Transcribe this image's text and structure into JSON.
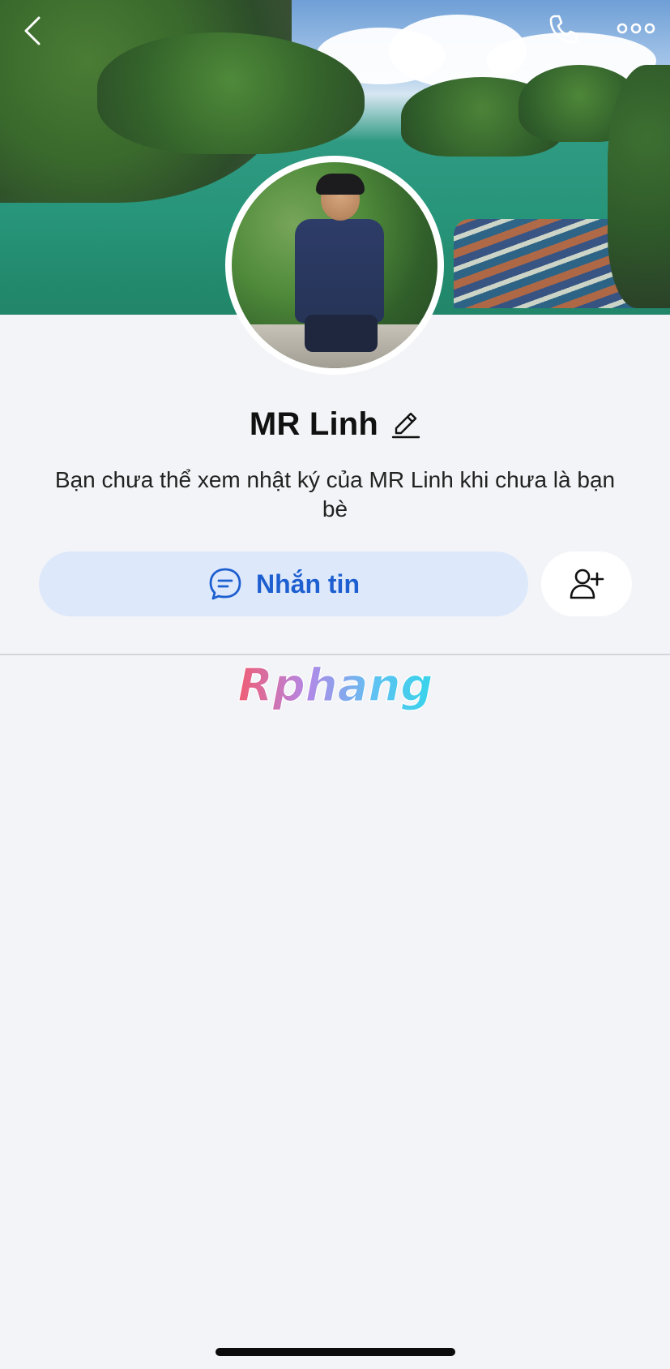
{
  "profile": {
    "name": "MR Linh",
    "notice": "Bạn chưa thể xem nhật ký của MR Linh khi chưa là bạn bè"
  },
  "actions": {
    "message_label": "Nhắn tin"
  },
  "watermark": {
    "text": "Rphang"
  },
  "icons": {
    "back": "chevron-left-icon",
    "call": "phone-icon",
    "more": "more-dots-icon",
    "edit": "pencil-icon",
    "message": "chat-bubble-icon",
    "add_friend": "add-user-icon"
  },
  "colors": {
    "accent": "#1d5fd0",
    "message_button_bg": "#dde8fb",
    "page_bg": "#f3f4f7"
  }
}
